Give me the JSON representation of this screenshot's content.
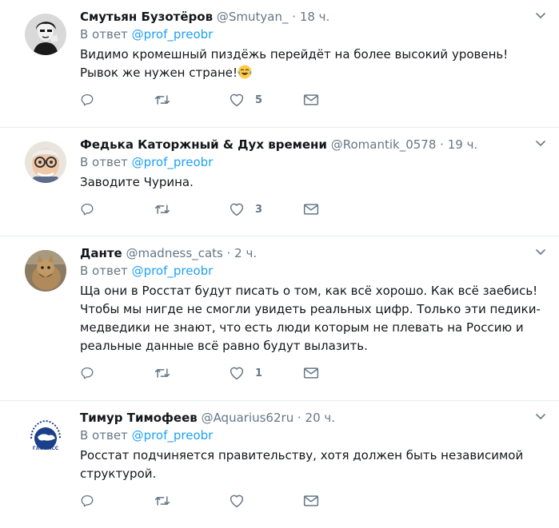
{
  "tweets": [
    {
      "name": "Смутьян Бузотёров",
      "handle": "@Smutyan_",
      "dot": "·",
      "time": "18 ч.",
      "reply_prefix": "В ответ",
      "reply_to": "@prof_preobr",
      "text": "Видимо кромешный пиздёжь перейдёт на более высокий уровень!Рывок же нужен стране!",
      "text_emoji": "face-with-tears-of-joy-emoji",
      "likes": "5",
      "retweets": "",
      "replies": ""
    },
    {
      "name": "Федька Каторжный & Дух времени",
      "handle": "@Romantik_0578",
      "dot": "·",
      "time": "19 ч.",
      "reply_prefix": "В ответ",
      "reply_to": "@prof_preobr",
      "text": "Заводите Чурина.",
      "likes": "3",
      "retweets": "",
      "replies": ""
    },
    {
      "name": "Данте",
      "handle": "@madness_cats",
      "dot": "·",
      "time": "2 ч.",
      "reply_prefix": "В ответ",
      "reply_to": "@prof_preobr",
      "text": "Ща они в Росстат будут писать о том, как всё хорошо. Как всё заебись! Чтобы мы нигде не смогли увидеть реальных цифр. Только эти педики-медведики не знают, что есть люди которым не плевать на Россию и реальные данные всё равно будут вылазить.",
      "likes": "1",
      "retweets": "",
      "replies": ""
    },
    {
      "name": "Тимур Тимофеев",
      "handle": "@Aquarius62ru",
      "dot": "·",
      "time": "20 ч.",
      "reply_prefix": "В ответ",
      "reply_to": "@prof_preobr",
      "text": "Росстат подчиняется правительству, хотя должен быть независимой структурой.",
      "avatar_text": "ГЛОНАСС",
      "likes": "",
      "retweets": "",
      "replies": ""
    }
  ],
  "icons": {
    "reply": "reply-icon",
    "retweet": "retweet-icon",
    "like": "heart-icon",
    "dm": "envelope-icon",
    "caret": "chevron-down-icon"
  },
  "colors": {
    "text": "#14171a",
    "muted": "#657786",
    "link": "#1da1f2",
    "border": "#e6ecf0"
  }
}
